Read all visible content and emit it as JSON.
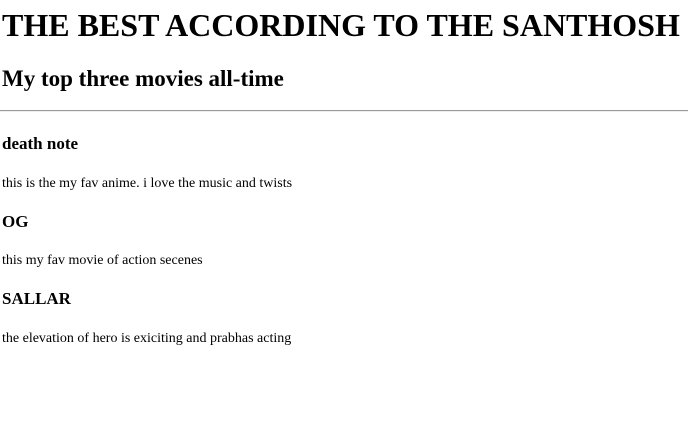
{
  "header": {
    "title": "THE BEST ACCORDING TO THE SANTHOSH",
    "subtitle": "My top three movies all-time"
  },
  "movies": [
    {
      "title": "death note",
      "description": "this is the my fav anime. i love the music and twists"
    },
    {
      "title": "OG",
      "description": "this my fav movie of action secenes"
    },
    {
      "title": "SALLAR",
      "description": "the elevation of hero is exiciting and prabhas acting"
    }
  ]
}
